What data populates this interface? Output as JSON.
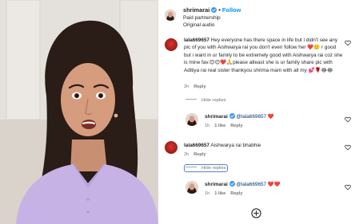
{
  "post": {
    "username": "shrimarai",
    "separator": "•",
    "follow_label": "Follow",
    "subtitle_1": "Paid partnership",
    "subtitle_2": "Original audio"
  },
  "comments": [
    {
      "username": "lala669657",
      "text": " Hey everyone has there space in life but i didn't see any pic of you with Aishwarya rai you don't even follow her ❤️🙂 r good but i want in ur family to be extremely good with Aishwarya rai coz she is mine fav.😊😊❤️🙏please atleast she is ur family share pic with Aditiya rai real sister thankyou shrima mam with all my 💕🌹😂😂",
      "time": "2h",
      "reply_label": "Reply",
      "hide_replies_label": "Hide replies",
      "reply": {
        "username": "shrimarai",
        "mention": "@lala669657",
        "emoji": "❤️",
        "time": "1h",
        "likes": "1 like",
        "reply_label": "Reply"
      }
    },
    {
      "username": "lala669657",
      "text": " Aishwarya rai bhabhie",
      "time": "2h",
      "reply_label": "Reply",
      "hide_replies_label": "Hide replies",
      "reply": {
        "username": "shrimarai",
        "mention": "@lala669657",
        "emoji": "❤️❤️",
        "time": "1h",
        "likes": "1 like",
        "reply_label": "Reply"
      }
    }
  ],
  "icons": {
    "verified": "verified-badge-icon",
    "like": "heart-outline-icon",
    "add": "add-circle-icon"
  },
  "colors": {
    "accent": "#0095f6",
    "verified": "#3897f0",
    "text": "#262626",
    "muted": "#737373",
    "video_top": "#e6e2dd",
    "dress": "#c7b2e6"
  }
}
